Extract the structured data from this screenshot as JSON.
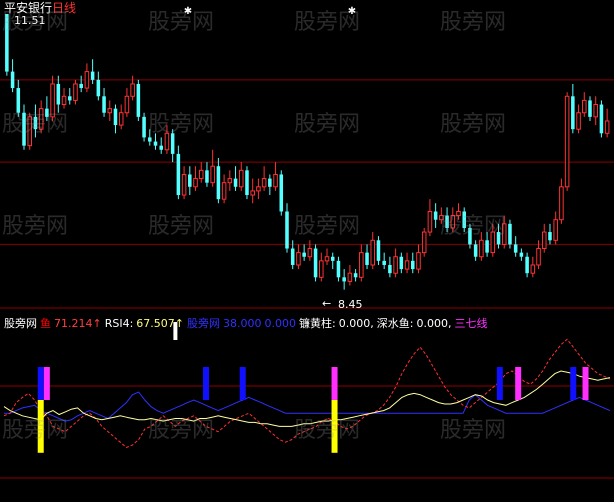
{
  "watermark": "股旁网",
  "price_panel": {
    "title": "平安银行",
    "period": "日线",
    "high_label": "11.51",
    "low_label": "8.45",
    "grid_prices": [
      11.0,
      10.0,
      9.0
    ]
  },
  "indicator_panel": {
    "items": [
      {
        "label": "股旁网",
        "color": "#ffffff"
      },
      {
        "label": "鱼",
        "color": "#ff0000"
      },
      {
        "label": "71.214↑",
        "color": "#ff4040"
      },
      {
        "label": "RSI4:",
        "color": "#ffffff"
      },
      {
        "label": "67.507↑",
        "color": "#ffff80"
      },
      {
        "label": "股旁网",
        "color": "#3030ff"
      },
      {
        "label": "38.000",
        "color": "#3030ff"
      },
      {
        "label": "0.000",
        "color": "#3030ff"
      },
      {
        "label": "镰黄柱:",
        "color": "#ffffff"
      },
      {
        "label": "0.000,",
        "color": "#ffffff"
      },
      {
        "label": "深水鱼:",
        "color": "#ffffff"
      },
      {
        "label": "0.000,",
        "color": "#ffffff"
      },
      {
        "label": "三七线",
        "color": "#ff30ff"
      }
    ]
  },
  "colors": {
    "up": "#ff3232",
    "down": "#54ffff",
    "grid": "#8b0000",
    "rsi_line": "#ffffa0",
    "fish_line": "#ff3030",
    "level_line": "#3030ff",
    "yellow_bar": "#ffff00",
    "magenta_bar": "#ff30ff",
    "blue_bar": "#1010ff",
    "white_bar": "#ffffff"
  },
  "chart_data": [
    {
      "type": "candlestick",
      "title": "平安银行 日线",
      "ylim": [
        8.3,
        11.8
      ],
      "annotations": [
        "11.51",
        "8.45"
      ],
      "candles": [
        [
          11.8,
          11.1,
          11.8,
          11.05,
          "down"
        ],
        [
          11.1,
          10.9,
          11.25,
          10.85,
          "down"
        ],
        [
          10.9,
          10.6,
          11.0,
          10.55,
          "down"
        ],
        [
          10.6,
          10.2,
          10.7,
          10.15,
          "down"
        ],
        [
          10.2,
          10.55,
          10.6,
          10.15,
          "up"
        ],
        [
          10.55,
          10.4,
          10.7,
          10.3,
          "down"
        ],
        [
          10.4,
          10.65,
          10.75,
          10.35,
          "up"
        ],
        [
          10.65,
          10.55,
          10.8,
          10.5,
          "down"
        ],
        [
          10.55,
          10.95,
          11.05,
          10.5,
          "up"
        ],
        [
          10.95,
          10.7,
          11.05,
          10.6,
          "down"
        ],
        [
          10.7,
          10.8,
          10.9,
          10.65,
          "up"
        ],
        [
          10.8,
          10.75,
          10.9,
          10.7,
          "down"
        ],
        [
          10.75,
          10.95,
          11.0,
          10.7,
          "up"
        ],
        [
          10.95,
          10.9,
          11.05,
          10.85,
          "down"
        ],
        [
          10.9,
          11.1,
          11.2,
          10.85,
          "up"
        ],
        [
          11.1,
          11.0,
          11.25,
          10.95,
          "down"
        ],
        [
          11.0,
          10.8,
          11.1,
          10.75,
          "down"
        ],
        [
          10.8,
          10.6,
          10.9,
          10.55,
          "down"
        ],
        [
          10.6,
          10.65,
          10.75,
          10.5,
          "up"
        ],
        [
          10.65,
          10.45,
          10.7,
          10.35,
          "down"
        ],
        [
          10.45,
          10.6,
          10.7,
          10.4,
          "up"
        ],
        [
          10.6,
          10.8,
          10.9,
          10.55,
          "up"
        ],
        [
          10.8,
          10.95,
          11.05,
          10.75,
          "up"
        ],
        [
          10.95,
          10.55,
          11.0,
          10.5,
          "down"
        ],
        [
          10.55,
          10.3,
          10.6,
          10.25,
          "down"
        ],
        [
          10.3,
          10.25,
          10.4,
          10.2,
          "down"
        ],
        [
          10.25,
          10.2,
          10.35,
          10.15,
          "down"
        ],
        [
          10.2,
          10.15,
          10.3,
          10.1,
          "down"
        ],
        [
          10.15,
          10.35,
          10.45,
          10.1,
          "up"
        ],
        [
          10.35,
          10.1,
          10.4,
          10.0,
          "down"
        ],
        [
          10.1,
          9.6,
          10.2,
          9.55,
          "down"
        ],
        [
          9.6,
          9.85,
          9.95,
          9.55,
          "up"
        ],
        [
          9.85,
          9.7,
          9.95,
          9.6,
          "down"
        ],
        [
          9.7,
          9.8,
          9.95,
          9.65,
          "up"
        ],
        [
          9.8,
          9.9,
          10.0,
          9.75,
          "up"
        ],
        [
          9.9,
          9.75,
          10.0,
          9.7,
          "down"
        ],
        [
          9.75,
          9.95,
          10.15,
          9.7,
          "up"
        ],
        [
          9.95,
          9.55,
          10.05,
          9.5,
          "down"
        ],
        [
          9.55,
          9.75,
          9.85,
          9.5,
          "up"
        ],
        [
          9.75,
          9.8,
          9.9,
          9.65,
          "up"
        ],
        [
          9.8,
          9.7,
          9.95,
          9.65,
          "down"
        ],
        [
          9.7,
          9.9,
          10.0,
          9.65,
          "up"
        ],
        [
          9.9,
          9.6,
          9.95,
          9.55,
          "down"
        ],
        [
          9.6,
          9.65,
          9.8,
          9.5,
          "up"
        ],
        [
          9.65,
          9.7,
          9.8,
          9.55,
          "up"
        ],
        [
          9.7,
          9.8,
          9.95,
          9.65,
          "up"
        ],
        [
          9.8,
          9.7,
          9.85,
          9.6,
          "down"
        ],
        [
          9.7,
          9.85,
          10.0,
          9.65,
          "up"
        ],
        [
          9.85,
          9.4,
          9.9,
          9.35,
          "down"
        ],
        [
          9.4,
          8.95,
          9.5,
          8.9,
          "down"
        ],
        [
          8.95,
          8.75,
          9.05,
          8.7,
          "down"
        ],
        [
          8.75,
          8.9,
          9.0,
          8.7,
          "up"
        ],
        [
          8.9,
          8.85,
          9.0,
          8.8,
          "down"
        ],
        [
          8.85,
          8.95,
          9.05,
          8.8,
          "up"
        ],
        [
          8.95,
          8.6,
          9.0,
          8.55,
          "down"
        ],
        [
          8.6,
          8.8,
          8.9,
          8.55,
          "up"
        ],
        [
          8.8,
          8.85,
          8.95,
          8.75,
          "up"
        ],
        [
          8.85,
          8.8,
          8.9,
          8.7,
          "down"
        ],
        [
          8.8,
          8.6,
          8.85,
          8.55,
          "down"
        ],
        [
          8.6,
          8.55,
          8.7,
          8.45,
          "down"
        ],
        [
          8.55,
          8.65,
          8.75,
          8.5,
          "up"
        ],
        [
          8.65,
          8.6,
          8.7,
          8.55,
          "down"
        ],
        [
          8.6,
          8.9,
          9.0,
          8.55,
          "up"
        ],
        [
          8.9,
          8.75,
          9.0,
          8.7,
          "down"
        ],
        [
          8.75,
          9.05,
          9.15,
          8.7,
          "up"
        ],
        [
          9.05,
          8.8,
          9.1,
          8.75,
          "down"
        ],
        [
          8.8,
          8.75,
          8.9,
          8.7,
          "down"
        ],
        [
          8.75,
          8.65,
          8.85,
          8.6,
          "down"
        ],
        [
          8.65,
          8.85,
          8.95,
          8.6,
          "up"
        ],
        [
          8.85,
          8.7,
          8.9,
          8.65,
          "down"
        ],
        [
          8.7,
          8.8,
          8.9,
          8.65,
          "up"
        ],
        [
          8.8,
          8.7,
          8.9,
          8.65,
          "down"
        ],
        [
          8.7,
          8.9,
          9.0,
          8.65,
          "up"
        ],
        [
          8.9,
          9.15,
          9.2,
          8.85,
          "up"
        ],
        [
          9.15,
          9.4,
          9.55,
          9.1,
          "up"
        ],
        [
          9.4,
          9.3,
          9.5,
          9.2,
          "down"
        ],
        [
          9.3,
          9.35,
          9.45,
          9.25,
          "up"
        ],
        [
          9.35,
          9.2,
          9.45,
          9.15,
          "down"
        ],
        [
          9.2,
          9.35,
          9.45,
          9.15,
          "up"
        ],
        [
          9.35,
          9.4,
          9.5,
          9.3,
          "up"
        ],
        [
          9.4,
          9.2,
          9.45,
          9.15,
          "down"
        ],
        [
          9.2,
          9.0,
          9.25,
          8.95,
          "down"
        ],
        [
          9.0,
          8.85,
          9.05,
          8.8,
          "down"
        ],
        [
          8.85,
          9.05,
          9.15,
          8.8,
          "up"
        ],
        [
          9.05,
          8.9,
          9.15,
          8.85,
          "down"
        ],
        [
          8.9,
          9.15,
          9.25,
          8.85,
          "up"
        ],
        [
          9.15,
          9.0,
          9.25,
          8.95,
          "down"
        ],
        [
          9.0,
          9.25,
          9.35,
          8.95,
          "up"
        ],
        [
          9.25,
          9.0,
          9.3,
          8.95,
          "down"
        ],
        [
          9.0,
          8.9,
          9.1,
          8.85,
          "down"
        ],
        [
          8.9,
          8.85,
          8.95,
          8.8,
          "down"
        ],
        [
          8.85,
          8.65,
          8.9,
          8.6,
          "down"
        ],
        [
          8.65,
          8.75,
          8.85,
          8.6,
          "up"
        ],
        [
          8.75,
          8.95,
          9.05,
          8.7,
          "up"
        ],
        [
          8.95,
          9.15,
          9.25,
          8.9,
          "up"
        ],
        [
          9.15,
          9.05,
          9.25,
          9.0,
          "down"
        ],
        [
          9.05,
          9.3,
          9.4,
          9.0,
          "up"
        ],
        [
          9.3,
          9.7,
          9.8,
          9.25,
          "up"
        ],
        [
          9.7,
          10.8,
          10.85,
          9.65,
          "up"
        ],
        [
          10.8,
          10.4,
          10.95,
          10.35,
          "down"
        ],
        [
          10.4,
          10.6,
          10.7,
          10.35,
          "up"
        ],
        [
          10.6,
          10.75,
          10.85,
          10.55,
          "up"
        ],
        [
          10.75,
          10.55,
          10.8,
          10.5,
          "down"
        ],
        [
          10.55,
          10.7,
          10.8,
          10.45,
          "up"
        ],
        [
          10.7,
          10.35,
          10.75,
          10.3,
          "down"
        ],
        [
          10.35,
          10.5,
          10.65,
          10.3,
          "up"
        ]
      ]
    },
    {
      "type": "line",
      "title": "",
      "ylim": [
        0,
        100
      ],
      "series": [
        {
          "name": "RSI4",
          "values": [
            45,
            42,
            40,
            38,
            37,
            36,
            35,
            40,
            42,
            39,
            41,
            43,
            44,
            40,
            38,
            36,
            35,
            36,
            37,
            38,
            37,
            36,
            35,
            35,
            36,
            35,
            34,
            35,
            36,
            36,
            35,
            34,
            36,
            36,
            37,
            38,
            37,
            36,
            35,
            34,
            33,
            33,
            32,
            32,
            31,
            30,
            30,
            30,
            31,
            32,
            32,
            33,
            34,
            34,
            35,
            35,
            36,
            37,
            38,
            39,
            40,
            41,
            42,
            44,
            48,
            52,
            54,
            55,
            54,
            52,
            50,
            48,
            47,
            47,
            48,
            50,
            52,
            54,
            53,
            50,
            48,
            47,
            46,
            48,
            50,
            52,
            55,
            58,
            62,
            66,
            70,
            72,
            71,
            70,
            68,
            67,
            66,
            65,
            66,
            67
          ]
        },
        {
          "name": "鱼",
          "values": [
            38,
            40,
            48,
            52,
            55,
            50,
            42,
            38,
            30,
            28,
            26,
            30,
            34,
            38,
            40,
            36,
            30,
            26,
            22,
            18,
            14,
            16,
            20,
            28,
            30,
            34,
            38,
            34,
            30,
            34,
            36,
            38,
            34,
            30,
            28,
            26,
            30,
            34,
            36,
            38,
            40,
            36,
            32,
            28,
            24,
            20,
            18,
            20,
            24,
            26,
            28,
            30,
            34,
            36,
            34,
            30,
            28,
            30,
            34,
            38,
            40,
            42,
            46,
            52,
            60,
            70,
            78,
            85,
            90,
            84,
            76,
            68,
            60,
            54,
            50,
            46,
            44,
            48,
            52,
            56,
            60,
            64,
            70,
            72,
            68,
            64,
            62,
            66,
            72,
            80,
            86,
            92,
            96,
            90,
            84,
            78,
            74,
            70,
            68,
            66
          ]
        },
        {
          "name": "",
          "values": [
            40,
            40,
            42,
            44,
            45,
            46,
            42,
            40,
            38,
            36,
            34,
            35,
            38,
            40,
            42,
            40,
            38,
            36,
            40,
            44,
            48,
            54,
            56,
            50,
            45,
            42,
            40,
            42,
            44,
            46,
            48,
            50,
            48,
            46,
            44,
            42,
            44,
            46,
            48,
            50,
            52,
            50,
            48,
            46,
            44,
            42,
            40,
            40,
            40,
            40,
            40,
            40,
            40,
            40,
            40,
            40,
            40,
            40,
            40,
            40,
            40,
            40,
            40,
            40,
            40,
            40,
            40,
            40,
            40,
            40,
            40,
            40,
            40,
            40,
            40,
            40,
            50,
            54,
            50,
            46,
            44,
            42,
            40,
            40,
            40,
            40,
            40,
            40,
            40,
            42,
            44,
            46,
            48,
            50,
            52,
            50,
            48,
            46,
            44,
            42
          ]
        }
      ],
      "markers": [
        {
          "type": "yellow",
          "index": 6
        },
        {
          "type": "blue",
          "index": 6
        },
        {
          "type": "magenta",
          "index": 7
        },
        {
          "type": "white",
          "index": 28
        },
        {
          "type": "blue",
          "index": 33
        },
        {
          "type": "blue",
          "index": 39
        },
        {
          "type": "magenta",
          "index": 54
        },
        {
          "type": "yellow",
          "index": 54
        },
        {
          "type": "blue",
          "index": 81
        },
        {
          "type": "magenta",
          "index": 84
        },
        {
          "type": "blue",
          "index": 93
        },
        {
          "type": "magenta",
          "index": 95
        }
      ]
    }
  ]
}
